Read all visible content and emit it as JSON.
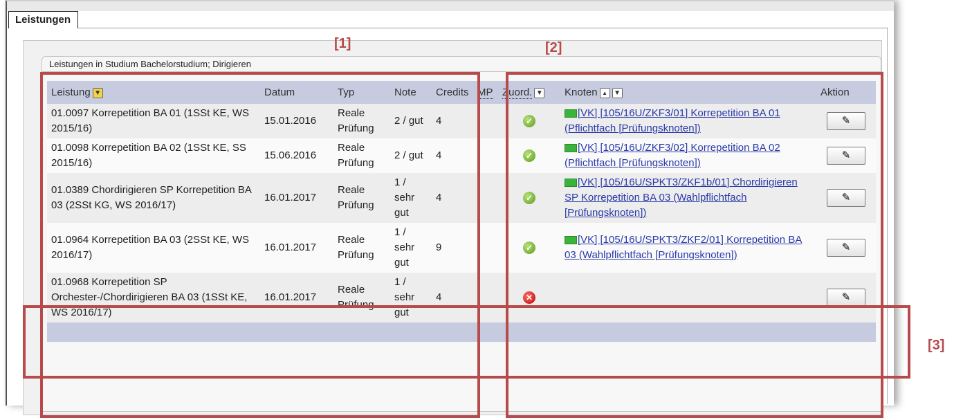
{
  "tab": {
    "label": "Leistungen"
  },
  "group": {
    "title": "Leistungen in Studium Bachelorstudium; Dirigieren"
  },
  "columns": {
    "leistung": "Leistung",
    "datum": "Datum",
    "typ": "Typ",
    "note": "Note",
    "credits": "Credits",
    "mp": "MP",
    "zuord": "Zuord.",
    "knoten": "Knoten",
    "aktion": "Aktion"
  },
  "rows": [
    {
      "leistung": "01.0097 Korrepetition BA 01 (1SSt KE, WS 2015/16)",
      "datum": "15.01.2016",
      "typ": "Reale Prüfung",
      "note": "2 / gut",
      "credits": "4",
      "zuord_status": "ok",
      "knoten": "[VK] [105/16U/ZKF3/01] Korrepetition BA 01 (Pflichtfach [Prüfungsknoten])"
    },
    {
      "leistung": "01.0098 Korrepetition BA 02 (1SSt KE, SS 2015/16)",
      "datum": "15.06.2016",
      "typ": "Reale Prüfung",
      "note": "2 / gut",
      "credits": "4",
      "zuord_status": "ok",
      "knoten": "[VK] [105/16U/ZKF3/02] Korrepetition BA 02 (Pflichtfach [Prüfungsknoten])"
    },
    {
      "leistung": "01.0389 Chordirigieren SP Korrepetition BA 03 (2SSt KG, WS 2016/17)",
      "datum": "16.01.2017",
      "typ": "Reale Prüfung",
      "note": "1 / sehr gut",
      "credits": "4",
      "zuord_status": "ok",
      "knoten": "[VK] [105/16U/SPKT3/ZKF1b/01] Chordirigieren SP Korrepetition BA 03 (Wahlpflichtfach [Prüfungsknoten])"
    },
    {
      "leistung": "01.0964 Korrepetition BA 03 (2SSt KE, WS 2016/17)",
      "datum": "16.01.2017",
      "typ": "Reale Prüfung",
      "note": "1 / sehr gut",
      "credits": "9",
      "zuord_status": "ok",
      "knoten": "[VK] [105/16U/SPKT3/ZKF2/01] Korrepetition BA 03 (Wahlpflichtfach [Prüfungsknoten])"
    },
    {
      "leistung": "01.0968 Korrepetition SP Orchester-/Chordirigieren BA 03 (1SSt KE, WS 2016/17)",
      "datum": "16.01.2017",
      "typ": "Reale Prüfung",
      "note": "1 / sehr gut",
      "credits": "4",
      "zuord_status": "error",
      "knoten": ""
    }
  ],
  "annotations": {
    "label1": "[1]",
    "label2": "[2]",
    "label3": "[3]"
  },
  "icons": {
    "ok": "check-circle-icon",
    "error": "x-circle-icon",
    "edit": "pencil-icon",
    "flag": "green-flag-icon",
    "filter": "filter-icon",
    "sort": "sort-up-icon"
  },
  "colors": {
    "header_bg": "#c6cbe0",
    "annotation": "#b74a4a",
    "link": "#2a3aa8"
  }
}
